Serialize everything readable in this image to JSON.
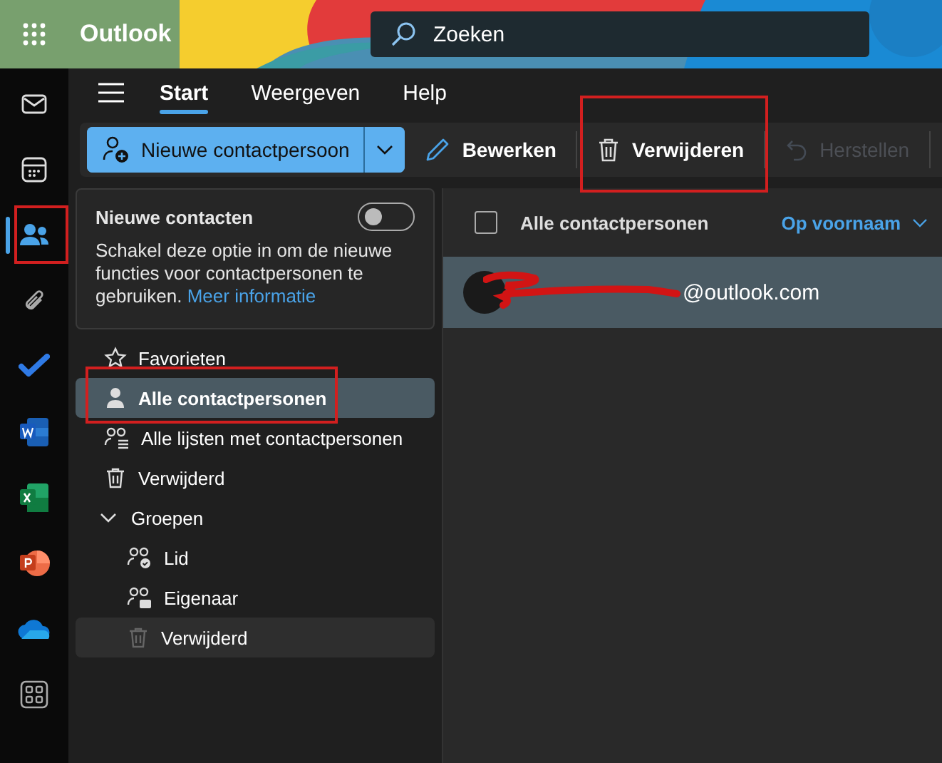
{
  "app": {
    "name": "Outlook"
  },
  "search": {
    "placeholder": "Zoeken"
  },
  "rail": [
    {
      "kind": "mail",
      "selected": false,
      "highlighted": false
    },
    {
      "kind": "calendar",
      "selected": false,
      "highlighted": false
    },
    {
      "kind": "people",
      "selected": true,
      "highlighted": true
    },
    {
      "kind": "attach",
      "selected": false,
      "highlighted": false
    },
    {
      "kind": "todo",
      "selected": false,
      "highlighted": false
    },
    {
      "kind": "word",
      "selected": false,
      "highlighted": false
    },
    {
      "kind": "excel",
      "selected": false,
      "highlighted": false
    },
    {
      "kind": "powerpoint",
      "selected": false,
      "highlighted": false
    },
    {
      "kind": "onedrive",
      "selected": false,
      "highlighted": false
    },
    {
      "kind": "apps",
      "selected": false,
      "highlighted": false
    }
  ],
  "ribbon_tabs": [
    {
      "label": "Start",
      "selected": true
    },
    {
      "label": "Weergeven",
      "selected": false
    },
    {
      "label": "Help",
      "selected": false
    }
  ],
  "toolbar": [
    {
      "kind": "new-contact",
      "label": "Nieuwe contactpersoon",
      "disabled": false,
      "highlighted": false
    },
    {
      "kind": "edit",
      "label": "Bewerken",
      "disabled": false,
      "highlighted": false
    },
    {
      "kind": "delete",
      "label": "Verwijderen",
      "disabled": false,
      "highlighted": true
    },
    {
      "kind": "restore",
      "label": "Herstellen",
      "disabled": true,
      "highlighted": false
    }
  ],
  "promo": {
    "title": "Nieuwe contacten",
    "toggle_on": false,
    "text": "Schakel deze optie in om de nieuwe functies voor contactpersonen te gebruiken.",
    "link": "Meer informatie"
  },
  "nav": [
    {
      "kind": "star",
      "label": "Favorieten",
      "selected": false,
      "hovered": false,
      "highlighted": false
    },
    {
      "kind": "person",
      "label": "Alle contactpersonen",
      "selected": true,
      "hovered": false,
      "highlighted": true
    },
    {
      "kind": "lists",
      "label": "Alle lijsten met contactpersonen",
      "selected": false,
      "hovered": false,
      "highlighted": false
    },
    {
      "kind": "trash",
      "label": "Verwijderd",
      "selected": false,
      "hovered": false,
      "highlighted": false
    },
    {
      "kind": "group",
      "label": "Groepen",
      "expanded": true,
      "selected": false,
      "hovered": false,
      "highlighted": false,
      "children": [
        {
          "kind": "member",
          "label": "Lid",
          "selected": false,
          "hovered": false,
          "highlighted": false
        },
        {
          "kind": "owner",
          "label": "Eigenaar",
          "selected": false,
          "hovered": false,
          "highlighted": false
        },
        {
          "kind": "trash",
          "label": "Verwijderd",
          "selected": false,
          "hovered": true,
          "highlighted": false
        }
      ]
    }
  ],
  "contacts": {
    "header": {
      "checked": false,
      "label": "Alle contactpersonen",
      "sort": "Op voornaam"
    },
    "rows": [
      {
        "email": "@outlook.com",
        "selected": true,
        "redacted": true
      }
    ]
  }
}
